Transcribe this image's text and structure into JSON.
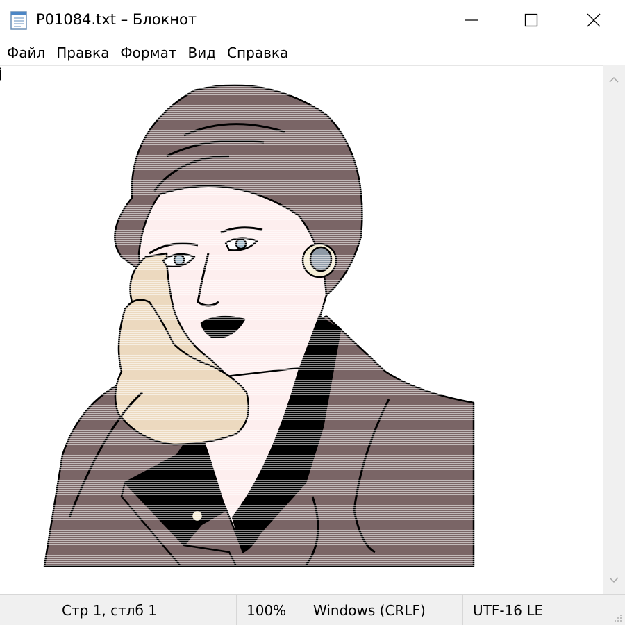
{
  "window": {
    "title": "P01084.txt – Блокнот",
    "icon": "notepad-icon"
  },
  "window_controls": {
    "minimize_icon": "minimize-icon",
    "maximize_icon": "maximize-icon",
    "close_icon": "close-icon"
  },
  "menu": {
    "items": [
      "Файл",
      "Правка",
      "Формат",
      "Вид",
      "Справка"
    ]
  },
  "editor": {
    "content": "ASCII-art illustration of a woman talking on a telephone handset",
    "art_colors": {
      "hair": "#7a6566",
      "skin": "#fdeeee",
      "jacket": "#7a6566",
      "collar": "#000000",
      "phone": "#ecd9bf",
      "earring_outer": "#f4ecd4",
      "earring_inner": "#8f9aa6",
      "eye": "#9fb8c8",
      "outline": "#000000"
    }
  },
  "statusbar": {
    "position": "Стр 1, стлб 1",
    "zoom": "100%",
    "line_endings": "Windows (CRLF)",
    "encoding": "UTF-16 LE"
  }
}
